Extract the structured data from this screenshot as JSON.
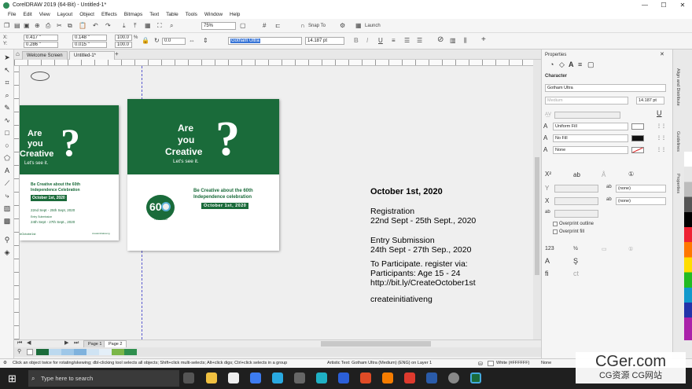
{
  "window": {
    "title": "CorelDRAW 2019 (64-Bit) - Untitled-1*",
    "minimize": "—",
    "maximize": "☐",
    "close": "✕"
  },
  "menu": [
    "File",
    "Edit",
    "View",
    "Layout",
    "Object",
    "Effects",
    "Bitmaps",
    "Text",
    "Table",
    "Tools",
    "Window",
    "Help"
  ],
  "toolbar1": {
    "zoom": "75%",
    "snap": "Snap To",
    "launch": "Launch"
  },
  "toolbar2": {
    "x": "0.417 \"",
    "y": "0.286 \"",
    "w": "0.148 \"",
    "h": "0.015 \"",
    "sx": "100.0",
    "sy": "100.0",
    "pct": "%",
    "angle": "0.0",
    "font": "Gotham Ultra",
    "size": "14.187 pt"
  },
  "tabs": {
    "welcome": "Welcome Screen",
    "doc": "Untitled-1*"
  },
  "canvas": {
    "left_card": {
      "are": "Are",
      "you": "you",
      "creative": "Creative",
      "tagline": "Let's see it.",
      "headline1": "Be Creative about the 60th",
      "headline2": "Independence Celebration",
      "date_badge": "October 1st, 2020",
      "reg": "22nd Sept - 25th Sept, 2020",
      "entry_label": "Entry Submission",
      "entry": "24th Sept - 27th Sept., 2020",
      "handle": "#Octobe1st",
      "handle2": "createinitiativeng"
    },
    "right_card": {
      "are": "Are",
      "you": "you",
      "creative": "Creative",
      "tagline": "Let's see it.",
      "headline1": "Be Creative about the 60th",
      "headline2": "Independence celebration",
      "date_badge": "October 1st, 2020",
      "logo_text": "60",
      "logo_sub": "TOGETHER"
    },
    "text": {
      "date": "October 1st, 2020",
      "reg_label": "Registration",
      "reg_dates": "22nd Sept - 25th Sept., 2020",
      "entry_label": "Entry Submission",
      "entry_dates": "24th Sept - 27th Sep., 2020",
      "participate": "To Participate. register via:",
      "participants": "Participants: Age 15 - 24",
      "url": "http://bit.ly/CreateOctober1st",
      "handle": "createinitiativeng"
    }
  },
  "pagebar": {
    "page1": "Page 1",
    "page2": "Page 2"
  },
  "panel": {
    "title": "Properties",
    "section": "Character",
    "font": "Gotham Ultra",
    "weight": "Medium",
    "size": "14.187 pt",
    "fill1": "Uniform Fill",
    "fill2": "No Fill",
    "outline": "None",
    "none1": "(none)",
    "none2": "(none)",
    "overprint_outline": "Overprint outline",
    "overprint_fill": "Overprint fill"
  },
  "sidetabs": [
    "Align and Distribute",
    "Guidelines",
    "Properties"
  ],
  "status": {
    "hint": "Click an object twice for rotating/skewing; dbl-clicking tool selects all objects; Shift+click multi-selects; Alt+click digs; Ctrl+click selects in a group",
    "object": "Artistic Text: Gotham Ultra (Medium) (ENG) on Layer 1",
    "fill": "White (#FFFFFF)",
    "outline": "None"
  },
  "taskbar": {
    "search": "Type here to search"
  },
  "watermark": {
    "main": "CGer.com",
    "sub": "CG资源 CG网站"
  },
  "colors": {
    "brand_green": "#1a6b3a",
    "accent": "#ffd84a"
  }
}
